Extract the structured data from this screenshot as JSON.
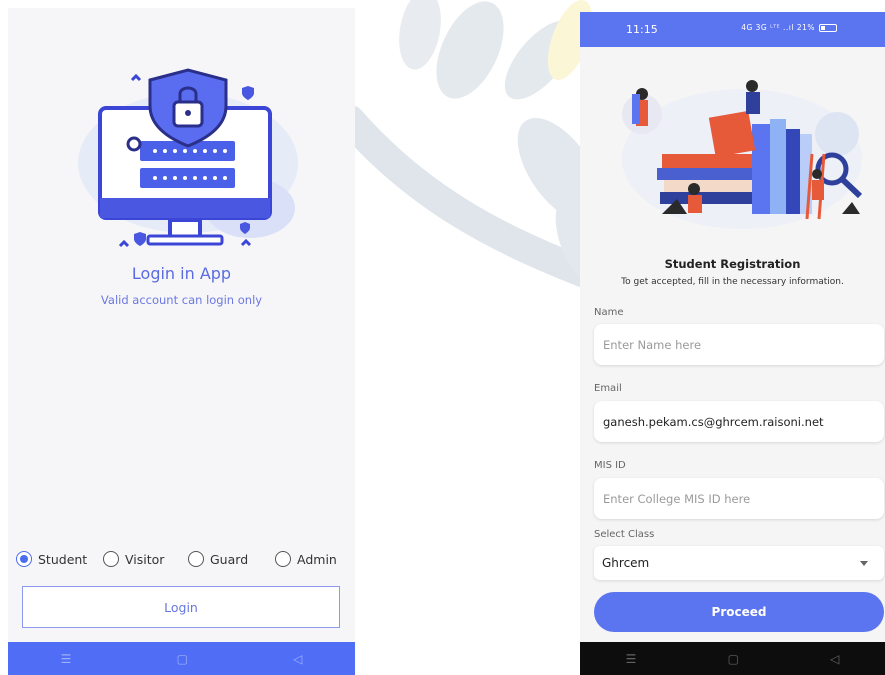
{
  "colors": {
    "accent": "#4f6ef5",
    "accent_light": "#6677e2",
    "bg": "#f6f6f8"
  },
  "login": {
    "title": "Login in App",
    "subtitle": "Valid account can login only",
    "roles": [
      {
        "label": "Student",
        "selected": true
      },
      {
        "label": "Visitor",
        "selected": false
      },
      {
        "label": "Guard",
        "selected": false
      },
      {
        "label": "Admin",
        "selected": false
      }
    ],
    "button_label": "Login",
    "nav": {
      "menu_icon": "menu-icon",
      "home_icon": "home-square-icon",
      "back_icon": "back-triangle-icon"
    }
  },
  "registration": {
    "status": {
      "time": "11:15",
      "icons": "4G 3G ᴸᵀᴱ ..ıl 21%"
    },
    "title": "Student Registration",
    "subtitle": "To get accepted, fill in the necessary information.",
    "fields": [
      {
        "label": "Name",
        "placeholder": "Enter Name here",
        "value": ""
      },
      {
        "label": "Email",
        "placeholder": "",
        "value": "ganesh.pekam.cs@ghrcem.raisoni.net"
      },
      {
        "label": "MIS ID",
        "placeholder": "Enter College MIS ID here",
        "value": ""
      }
    ],
    "select": {
      "label": "Select Class",
      "value": "Ghrcem"
    },
    "button_label": "Proceed"
  }
}
